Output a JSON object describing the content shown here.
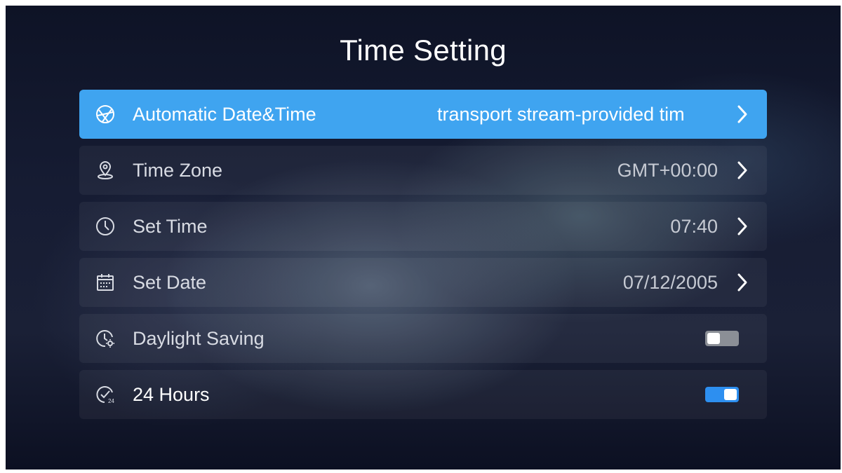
{
  "page": {
    "title": "Time Setting"
  },
  "colors": {
    "accent": "#3fa4f0",
    "toggle_on": "#2d8ff0",
    "toggle_off": "#8b8f96"
  },
  "rows": [
    {
      "label": "Automatic Date&Time",
      "value": "transport stream-provided tim",
      "icon": "globe-icon",
      "selected": true
    },
    {
      "label": "Time Zone",
      "value": "GMT+00:00",
      "icon": "location-pin-icon"
    },
    {
      "label": "Set Time",
      "value": "07:40",
      "icon": "clock-icon"
    },
    {
      "label": "Set Date",
      "value": "07/12/2005",
      "icon": "calendar-icon"
    },
    {
      "label": "Daylight Saving",
      "toggle": "off",
      "icon": "daylight-clock-icon"
    },
    {
      "label": "24 Hours",
      "toggle": "on",
      "icon": "clock-24-icon"
    }
  ]
}
